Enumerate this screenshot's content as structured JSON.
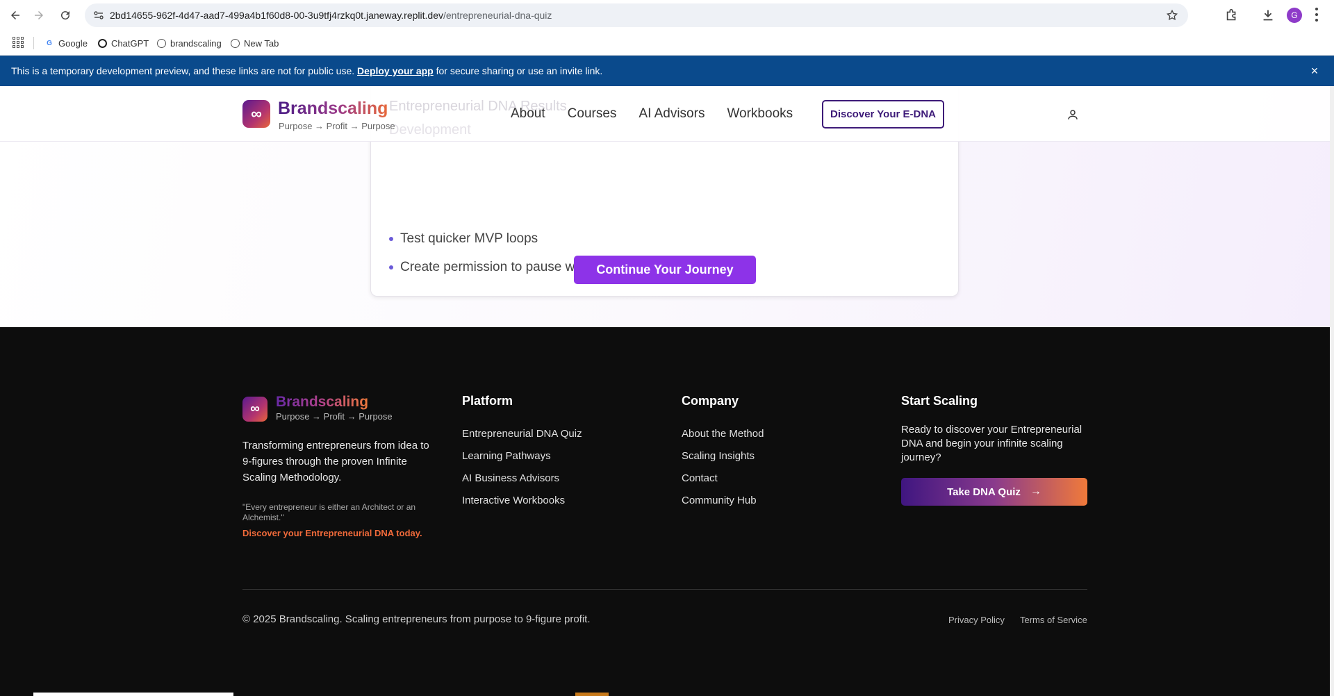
{
  "browser": {
    "url_host": "2bd14655-962f-4d47-aad7-499a4b1f60d8-00-3u9tfj4rzkq0t.janeway.replit.dev",
    "url_path": "/entrepreneurial-dna-quiz",
    "profile_initial": "G",
    "bookmarks": [
      "Google",
      "ChatGPT",
      "brandscaling",
      "New Tab"
    ]
  },
  "dev_banner": {
    "text_before": "This is a temporary development preview, and these links are not for public use. ",
    "link": "Deploy your app",
    "text_after": " for secure sharing or use an invite link.",
    "close": "×"
  },
  "header": {
    "logo_symbol": "∞",
    "brand": "Brandscaling",
    "tagline": "Purpose → Profit → Purpose",
    "nav": [
      "About",
      "Courses",
      "AI Advisors",
      "Workbooks"
    ],
    "cta": "Discover Your E-DNA",
    "ghost_line": "Entrepreneurial DNA Results",
    "ghost_line2": "Development"
  },
  "card": {
    "bullets": [
      "Test quicker MVP loops",
      "Create permission to pause without guilt"
    ]
  },
  "continue_button": "Continue Your Journey",
  "footer": {
    "logo_symbol": "∞",
    "brand": "Brandscaling",
    "tagline": "Purpose → Profit → Purpose",
    "description": "Transforming entrepreneurs from idea to 9-figures through the proven Infinite Scaling Methodology.",
    "quote": "\"Every entrepreneur is either an Architect or an Alchemist.\"",
    "quote_cta": "Discover your Entrepreneurial DNA today.",
    "platform": {
      "title": "Platform",
      "links": [
        "Entrepreneurial DNA Quiz",
        "Learning Pathways",
        "AI Business Advisors",
        "Interactive Workbooks"
      ]
    },
    "company": {
      "title": "Company",
      "links": [
        "About the Method",
        "Scaling Insights",
        "Contact",
        "Community Hub"
      ]
    },
    "start": {
      "title": "Start Scaling",
      "text": "Ready to discover your Entrepreneurial DNA and begin your infinite scaling journey?",
      "button": "Take DNA Quiz",
      "button_arrow": "→"
    },
    "copyright": "© 2025 Brandscaling. Scaling entrepreneurs from purpose to 9-figure profit.",
    "legal": [
      "Privacy Policy",
      "Terms of Service"
    ]
  },
  "colors": {
    "banner": "#0a4a8c",
    "primary_purple": "#8d33e8",
    "footer_bg": "#0d0d0d",
    "accent_orange": "#f06a3a"
  }
}
